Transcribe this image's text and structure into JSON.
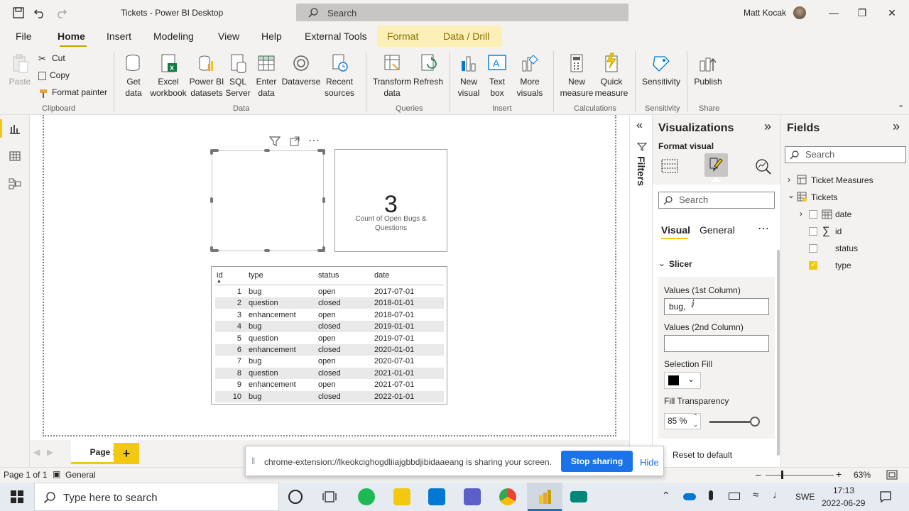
{
  "window": {
    "title": "Tickets - Power BI Desktop",
    "search_placeholder": "Search",
    "user_name": "Matt Kocak"
  },
  "menu": {
    "tabs": [
      "File",
      "Home",
      "Insert",
      "Modeling",
      "View",
      "Help",
      "External Tools",
      "Format",
      "Data / Drill"
    ],
    "active": "Home"
  },
  "ribbon": {
    "clipboard": {
      "paste": "Paste",
      "cut": "Cut",
      "copy": "Copy",
      "format_painter": "Format painter",
      "label": "Clipboard"
    },
    "data": {
      "get_data": "Get data",
      "excel": "Excel workbook",
      "pbi_datasets": "Power BI datasets",
      "sql": "SQL Server",
      "enter": "Enter data",
      "dataverse": "Dataverse",
      "recent": "Recent sources",
      "label": "Data"
    },
    "queries": {
      "transform": "Transform data",
      "refresh": "Refresh",
      "label": "Queries"
    },
    "insert": {
      "new_visual": "New visual",
      "text_box": "Text box",
      "more_visuals": "More visuals",
      "label": "Insert"
    },
    "calculations": {
      "new_measure": "New measure",
      "quick_measure": "Quick measure",
      "label": "Calculations"
    },
    "sensitivity": {
      "sensitivity": "Sensitivity",
      "label": "Sensitivity"
    },
    "share": {
      "publish": "Publish",
      "label": "Share"
    }
  },
  "card": {
    "value": "3",
    "label": "Count of Open Bugs & Questions"
  },
  "table": {
    "headers": [
      "id",
      "type",
      "status",
      "date"
    ],
    "rows": [
      [
        "1",
        "bug",
        "open",
        "2017-07-01"
      ],
      [
        "2",
        "question",
        "closed",
        "2018-01-01"
      ],
      [
        "3",
        "enhancement",
        "open",
        "2018-07-01"
      ],
      [
        "4",
        "bug",
        "closed",
        "2019-01-01"
      ],
      [
        "5",
        "question",
        "open",
        "2019-07-01"
      ],
      [
        "6",
        "enhancement",
        "closed",
        "2020-01-01"
      ],
      [
        "7",
        "bug",
        "open",
        "2020-07-01"
      ],
      [
        "8",
        "question",
        "closed",
        "2021-01-01"
      ],
      [
        "9",
        "enhancement",
        "open",
        "2021-07-01"
      ],
      [
        "10",
        "bug",
        "closed",
        "2022-01-01"
      ]
    ]
  },
  "filters": {
    "label": "Filters"
  },
  "visualizations": {
    "title": "Visualizations",
    "subtitle": "Format visual",
    "search_placeholder": "Search",
    "tabs": [
      "Visual",
      "General"
    ],
    "section": "Slicer",
    "values_1st_label": "Values (1st Column)",
    "values_1st_value": "bug,",
    "values_2nd_label": "Values (2nd Column)",
    "values_2nd_value": "",
    "selection_fill_label": "Selection Fill",
    "selection_fill_color": "#000000",
    "fill_transparency_label": "Fill Transparency",
    "fill_transparency_value": "85",
    "fill_transparency_unit": "%",
    "reset": "Reset to default"
  },
  "fields": {
    "title": "Fields",
    "search_placeholder": "Search",
    "tables": [
      {
        "name": "Ticket Measures",
        "expanded": false
      },
      {
        "name": "Tickets",
        "expanded": true,
        "fields": [
          {
            "name": "date",
            "checked": false
          },
          {
            "name": "id",
            "checked": false
          },
          {
            "name": "status",
            "checked": false
          },
          {
            "name": "type",
            "checked": true
          }
        ]
      }
    ]
  },
  "pages": {
    "tabs": [
      "Page 1"
    ],
    "add": "+"
  },
  "status": {
    "page": "Page 1 of 1",
    "sensitivity": "General",
    "zoom": "63%"
  },
  "screen_share": {
    "message": "chrome-extension://lkeokcighogdliiajgbbdjibidaaeang is sharing your screen.",
    "stop": "Stop sharing",
    "hide": "Hide"
  },
  "taskbar": {
    "search_placeholder": "Type here to search",
    "lang": "SWE",
    "time": "17:13",
    "date": "2022-06-29"
  },
  "colors": {
    "accent": "#f2c811",
    "share_button": "#1a73e8"
  }
}
